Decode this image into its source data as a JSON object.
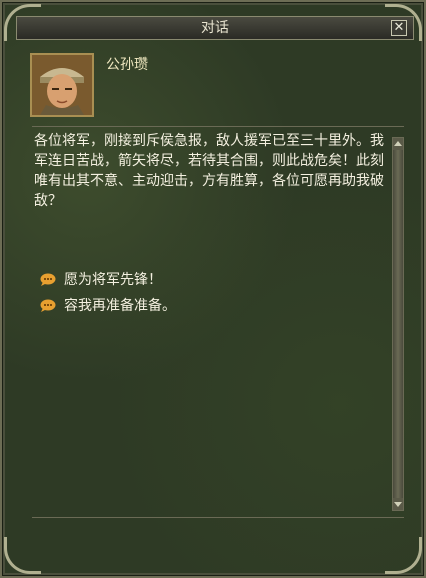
{
  "window": {
    "title": "对话",
    "close_icon": "close-icon"
  },
  "speaker": {
    "name": "公孙瓒",
    "portrait_icon": "portrait-icon"
  },
  "dialog": {
    "text": "各位将军，刚接到斥侯急报，敌人援军已至三十里外。我军连日苦战，箭矢将尽，若待其合围，则此战危矣！此刻唯有出其不意、主动迎击，方有胜算，各位可愿再助我破敌？"
  },
  "options": [
    {
      "label": "愿为将军先锋！",
      "icon": "speech-bubble-icon"
    },
    {
      "label": "容我再准备准备。",
      "icon": "speech-bubble-icon"
    }
  ],
  "colors": {
    "panel_bg": "#2e3a25",
    "text": "#f4f0e0",
    "title": "#e8e4d0"
  }
}
